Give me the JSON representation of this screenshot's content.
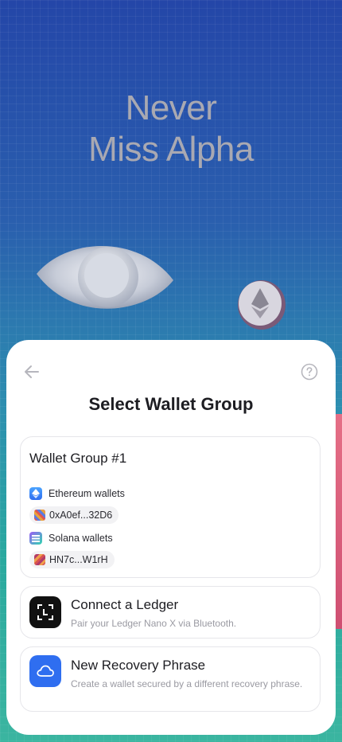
{
  "hero": {
    "line1": "Never",
    "line2": "Miss Alpha"
  },
  "sheet": {
    "title": "Select Wallet Group",
    "back_icon": "arrow-left-icon",
    "help_icon": "question-circle-icon"
  },
  "wallet_group": {
    "name": "Wallet Group #1",
    "chains": [
      {
        "label": "Ethereum wallets",
        "icon": "ethereum-icon",
        "address": "0xA0ef...32D6"
      },
      {
        "label": "Solana wallets",
        "icon": "solana-icon",
        "address": "HN7c...W1rH"
      }
    ]
  },
  "options": [
    {
      "title": "Connect a Ledger",
      "description": "Pair your Ledger Nano X via Bluetooth.",
      "icon": "ledger-icon",
      "icon_bg": "#111111"
    },
    {
      "title": "New Recovery Phrase",
      "description": "Create a wallet secured by a different recovery phrase.",
      "icon": "cloud-icon",
      "icon_bg": "#2f6ef0"
    }
  ]
}
